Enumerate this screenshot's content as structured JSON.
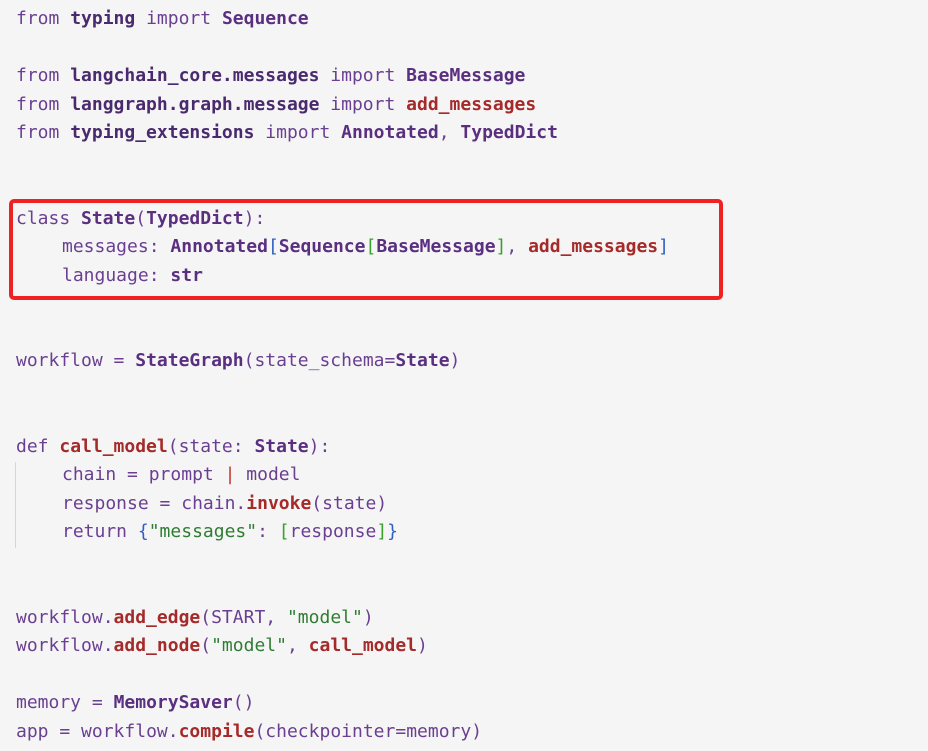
{
  "code": {
    "import_typing": {
      "kw_from": "from",
      "module": "typing",
      "kw_import": "import",
      "name": "Sequence"
    },
    "import_messages": {
      "kw_from": "from",
      "module": "langchain_core.messages",
      "kw_import": "import",
      "name": "BaseMessage"
    },
    "import_graph": {
      "kw_from": "from",
      "module": "langgraph.graph.message",
      "kw_import": "import",
      "name": "add_messages"
    },
    "import_ext": {
      "kw_from": "from",
      "module": "typing_extensions",
      "kw_import": "import",
      "name1": "Annotated",
      "sep": ",",
      "name2": "TypedDict"
    },
    "class_def": {
      "kw_class": "class",
      "name": "State",
      "open": "(",
      "base": "TypedDict",
      "close": "):"
    },
    "field_messages": {
      "name": "messages",
      "colon": ":",
      "t_annotated": "Annotated",
      "b1": "[",
      "t_sequence": "Sequence",
      "b2": "[",
      "t_base": "BaseMessage",
      "b3": "]",
      "comma": ",",
      "t_add": "add_messages",
      "b4": "]"
    },
    "field_language": {
      "name": "language",
      "colon": ":",
      "type": "str"
    },
    "workflow_line": {
      "var": "workflow",
      "eq": "=",
      "fn": "StateGraph",
      "open": "(",
      "arg": "state_schema",
      "eq2": "=",
      "val": "State",
      "close": ")"
    },
    "def_line": {
      "kw_def": "def",
      "name": "call_model",
      "open": "(",
      "param": "state",
      "colon": ":",
      "type": "State",
      "close": "):"
    },
    "chain_line": {
      "var": "chain",
      "eq": "=",
      "a": "prompt",
      "pipe": "|",
      "b": "model"
    },
    "response_line": {
      "var": "response",
      "eq": "=",
      "obj": "chain",
      "dot": ".",
      "fn": "invoke",
      "open": "(",
      "arg": "state",
      "close": ")"
    },
    "return_line": {
      "kw_return": "return",
      "open": "{",
      "key": "\"messages\"",
      "colon": ":",
      "lb": "[",
      "val": "response",
      "rb": "]",
      "close": "}"
    },
    "add_edge_line": {
      "obj": "workflow",
      "dot": ".",
      "fn": "add_edge",
      "open": "(",
      "arg1": "START",
      "comma": ",",
      "arg2": "\"model\"",
      "close": ")"
    },
    "add_node_line": {
      "obj": "workflow",
      "dot": ".",
      "fn": "add_node",
      "open": "(",
      "arg1": "\"model\"",
      "comma": ",",
      "arg2": "call_model",
      "close": ")"
    },
    "memory_line": {
      "var": "memory",
      "eq": "=",
      "fn": "MemorySaver",
      "parens": "()"
    },
    "app_line": {
      "var": "app",
      "eq": "=",
      "obj": "workflow",
      "dot": ".",
      "fn": "compile",
      "open": "(",
      "arg": "checkpointer",
      "eq2": "=",
      "val": "memory",
      "close": ")"
    }
  },
  "colors": {
    "highlight_border": "#ee2222",
    "background": "#f5f5f5",
    "keyword": "#6a3f92",
    "function": "#a52a2a",
    "string": "#2e7d32"
  }
}
